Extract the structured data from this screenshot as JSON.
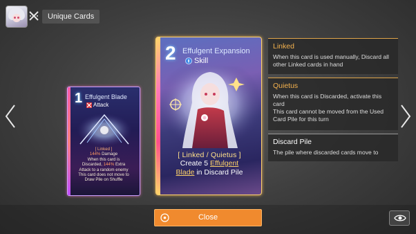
{
  "header": {
    "title": "Unique Cards"
  },
  "card_small": {
    "cost": "1",
    "name": "Effulgent Blade",
    "type": "Attack",
    "desc_keyword": "[ Linked ]",
    "desc_damage": "144%",
    "desc_damage_label": " Damage",
    "desc_line2": "When this card is",
    "desc_line3a": "Discarded, ",
    "desc_extra": "144%",
    "desc_line3b": " Extra",
    "desc_line4": "Attack to a random enemy",
    "desc_line5": "This card does not move to",
    "desc_line6": "Draw Pile on Shuffle"
  },
  "card_big": {
    "cost": "2",
    "name": "Effulgent Expansion",
    "type": "Skill",
    "desc_keywords": "[ Linked / Quietus ]",
    "desc_create": "Create 5 ",
    "desc_link1": "Effulgent",
    "desc_link2": "Blade",
    "desc_tail": " in Discard Pile"
  },
  "info": [
    {
      "title": "Linked",
      "body": "When this card is used manually, Discard all other Linked cards in hand"
    },
    {
      "title": "Quietus",
      "body": "When this card is Discarded, activate this card",
      "body2": "This card cannot be moved from the Used Card Pile for this turn"
    },
    {
      "title": "Discard Pile",
      "body": "The pile where discarded cards move to"
    }
  ],
  "buttons": {
    "close_label": "Close"
  },
  "colors": {
    "accent": "#f08a2e",
    "keyword": "#f3b14e",
    "highlight": "#ff9a63"
  }
}
